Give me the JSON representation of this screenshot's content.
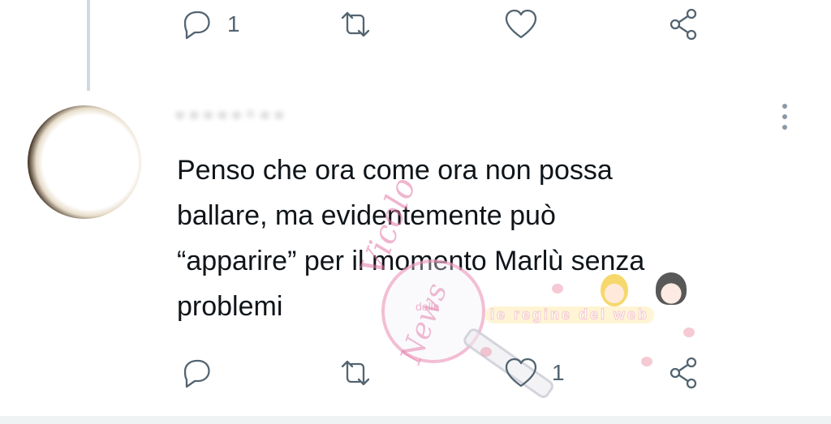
{
  "previous_tweet": {
    "actions": {
      "reply_icon": "reply-icon",
      "reply_count": "1",
      "retweet_icon": "retweet-icon",
      "like_icon": "like-icon",
      "share_icon": "share-icon"
    }
  },
  "tweet": {
    "avatar_icon": "avatar",
    "author_name": "- - - - -  · - -",
    "more_icon": "more-options-icon",
    "text": "Penso che ora come ora non possa\nballare, ma evidentemente può\n“apparire” per il momento Marlù senza\nproblemi",
    "actions": {
      "reply_icon": "reply-icon",
      "retweet_icon": "retweet-icon",
      "like_icon": "like-icon",
      "like_count": "1",
      "share_icon": "share-icon"
    }
  },
  "watermark": {
    "title_line1": "Vicolo",
    "title_small": "delle",
    "title_line2": "News",
    "banner": "le regine del web"
  },
  "colors": {
    "icon_gray": "#536471",
    "text": "#0f1419",
    "thread_line": "#cfd9de"
  }
}
